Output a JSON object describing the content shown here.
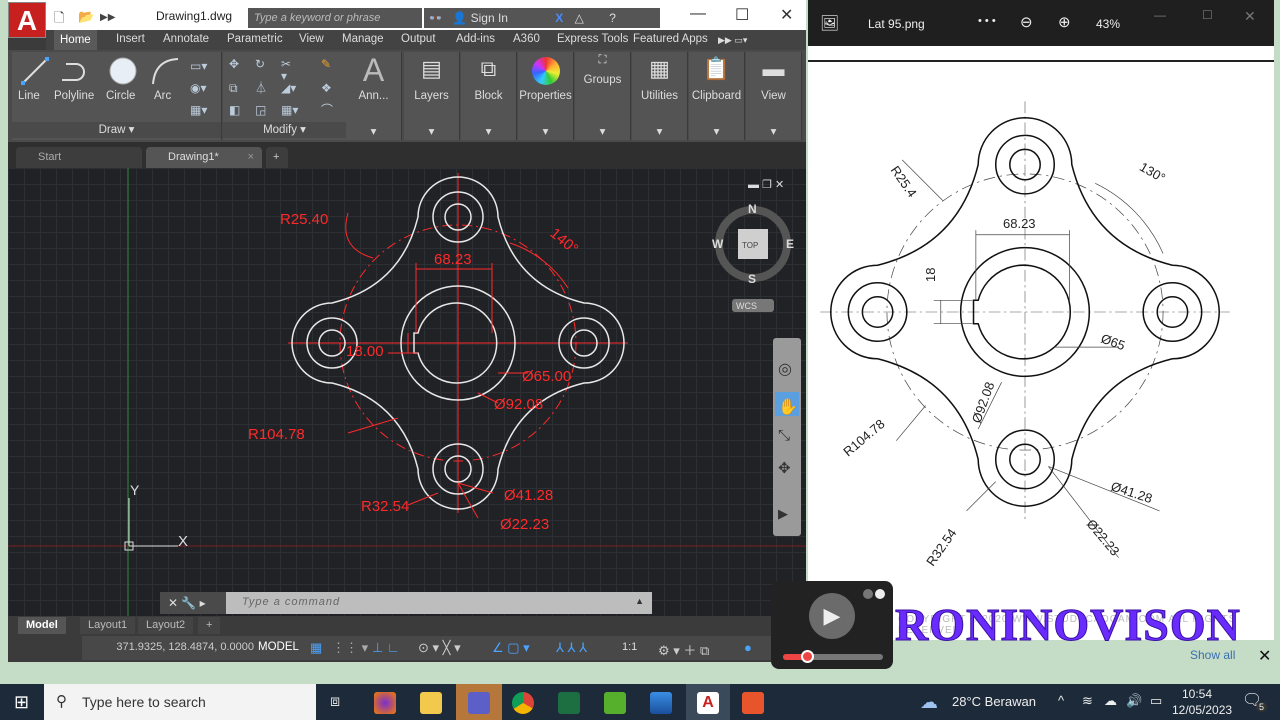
{
  "autocad": {
    "title": "Drawing1.dwg",
    "search_placeholder": "Type a keyword or phrase",
    "sign_in": "Sign In",
    "ribbon_tabs": [
      "Home",
      "Insert",
      "Annotate",
      "Parametric",
      "View",
      "Manage",
      "Output",
      "Add-ins",
      "A360",
      "Express Tools",
      "Featured Apps"
    ],
    "draw_tools": [
      "Line",
      "Polyline",
      "Circle",
      "Arc"
    ],
    "draw_panel": "Draw",
    "modify_panel": "Modify",
    "panels": [
      "Ann...",
      "Layers",
      "Block",
      "Properties",
      "Groups",
      "Utilities",
      "Clipboard",
      "View"
    ],
    "doc_tabs": [
      "Start",
      "Drawing1*"
    ],
    "viewcube": {
      "n": "N",
      "s": "S",
      "e": "E",
      "w": "W",
      "top": "TOP",
      "wcs": "WCS"
    },
    "ucs": {
      "x": "X",
      "y": "Y"
    },
    "dims": {
      "r1": "R25.40",
      "ang": "140°",
      "w": "68.23",
      "h": "18.00",
      "d1": "Ø65.00",
      "d2": "Ø92.08",
      "r2": "R104.78",
      "d3": "Ø41.28",
      "r3": "R32.54",
      "d4": "Ø22.23"
    },
    "command_placeholder": "Type a command",
    "layout_tabs": [
      "Model",
      "Layout1",
      "Layout2"
    ],
    "coords": "371.9325, 128.4874, 0.0000",
    "model_label": "MODEL",
    "scale": "1:1",
    "line_color": "#e8e8e8",
    "dim_color": "#ff2a2a"
  },
  "viewer": {
    "filename": "Lat 95.png",
    "more": "• • •",
    "zoom": "43%",
    "dims": {
      "r1": "R25.4",
      "ang": "130°",
      "w": "68.23",
      "h": "18",
      "d1": "Ø65",
      "d2": "Ø92.08",
      "r2": "R104.78",
      "d3": "Ø41.28",
      "r3": "R32.54",
      "d4": "Ø22.23"
    },
    "copyright": "COPYRIGHT © 2020 WWW.STUDYCADCAM.COM ALL RIGHTS RESERVED"
  },
  "watermark": "RONINOVISON",
  "notification": {
    "show_all": "Show all"
  },
  "taskbar": {
    "search_placeholder": "Type here to search",
    "weather": "28°C  Berawan",
    "time": "10:54",
    "date": "12/05/2023",
    "notifications": "5"
  }
}
